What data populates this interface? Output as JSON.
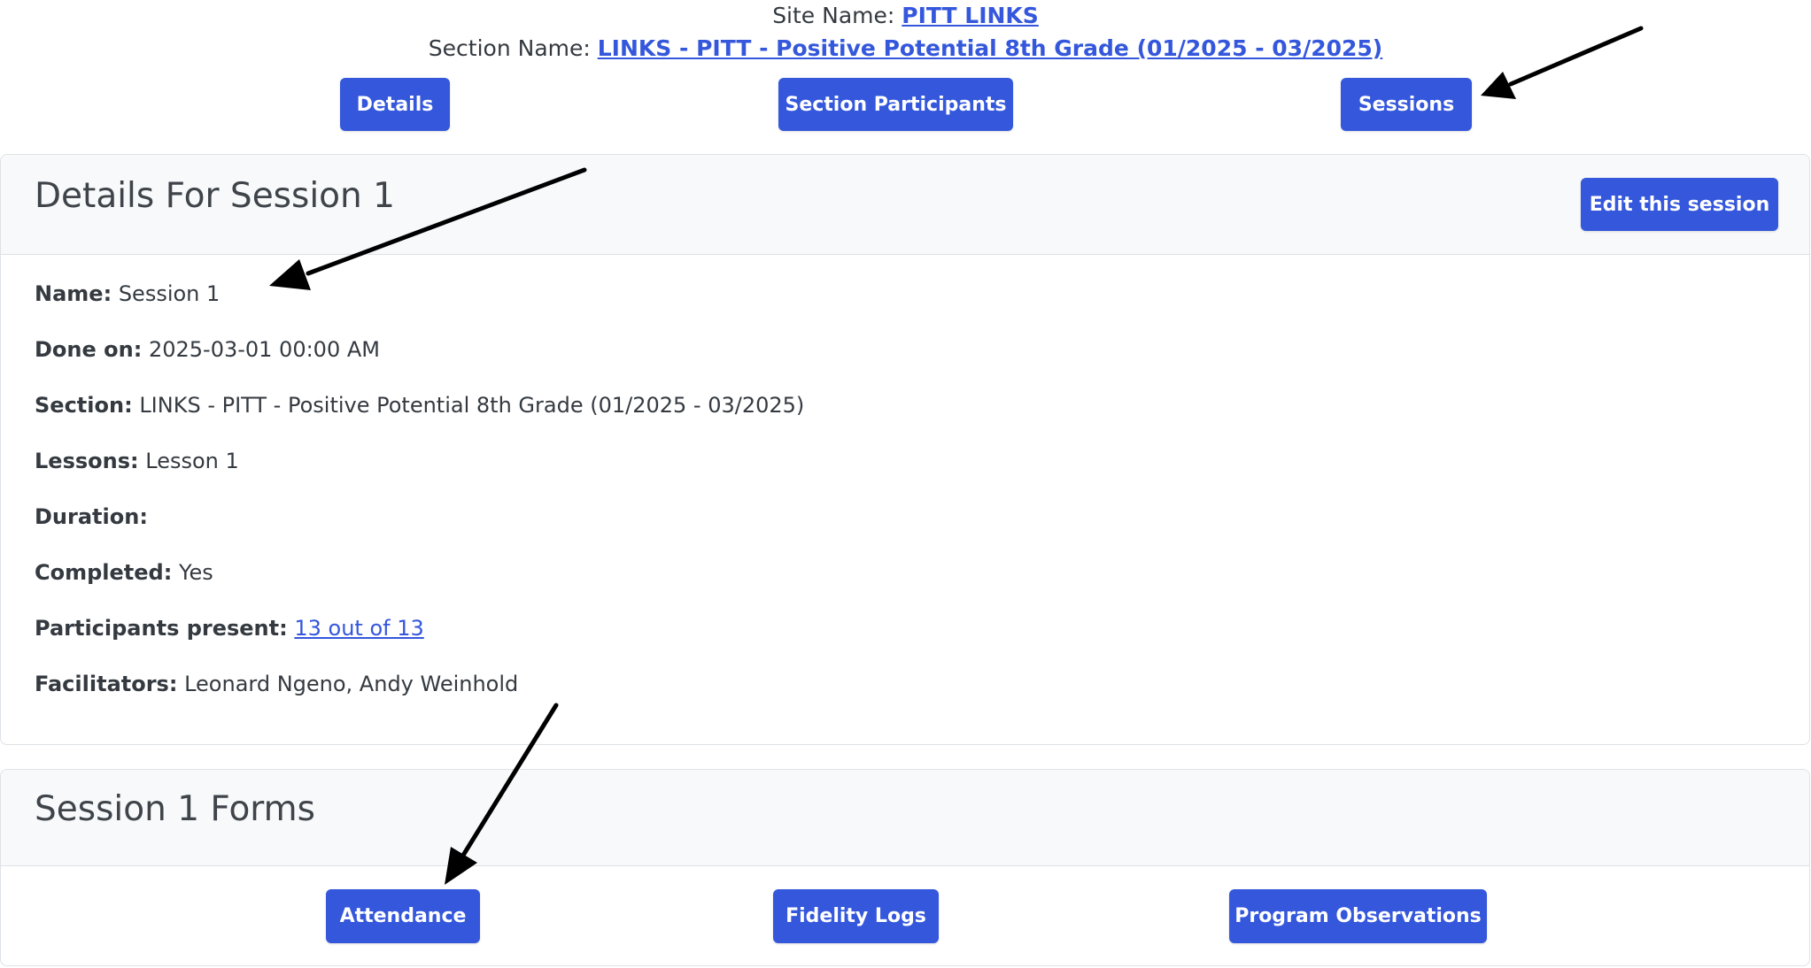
{
  "header": {
    "site_label": "Site Name:",
    "site_value": "PITT LINKS",
    "section_label": "Section Name:",
    "section_value": "LINKS - PITT - Positive Potential 8th Grade (01/2025 - 03/2025)"
  },
  "nav": {
    "details": "Details",
    "participants": "Section Participants",
    "sessions": "Sessions"
  },
  "details_card": {
    "title": "Details For Session 1",
    "edit_label": "Edit this session",
    "fields": {
      "name": {
        "label": "Name:",
        "value": "Session 1"
      },
      "done_on": {
        "label": "Done on:",
        "value": "2025-03-01 00:00 AM"
      },
      "section": {
        "label": "Section:",
        "value": "LINKS - PITT - Positive Potential 8th Grade (01/2025 - 03/2025)"
      },
      "lessons": {
        "label": "Lessons:",
        "value": "Lesson 1"
      },
      "duration": {
        "label": "Duration:",
        "value": ""
      },
      "completed": {
        "label": "Completed:",
        "value": "Yes"
      },
      "participants": {
        "label": "Participants present:",
        "value": "13 out of 13"
      },
      "facilitators": {
        "label": "Facilitators:",
        "value": "Leonard Ngeno, Andy Weinhold"
      }
    }
  },
  "forms_card": {
    "title": "Session 1 Forms",
    "attendance": "Attendance",
    "fidelity": "Fidelity Logs",
    "observations": "Program Observations"
  },
  "colors": {
    "primary": "#3457dc",
    "text": "#343a40",
    "card_header_bg": "#f8f9fa",
    "border": "#dee2e6"
  }
}
